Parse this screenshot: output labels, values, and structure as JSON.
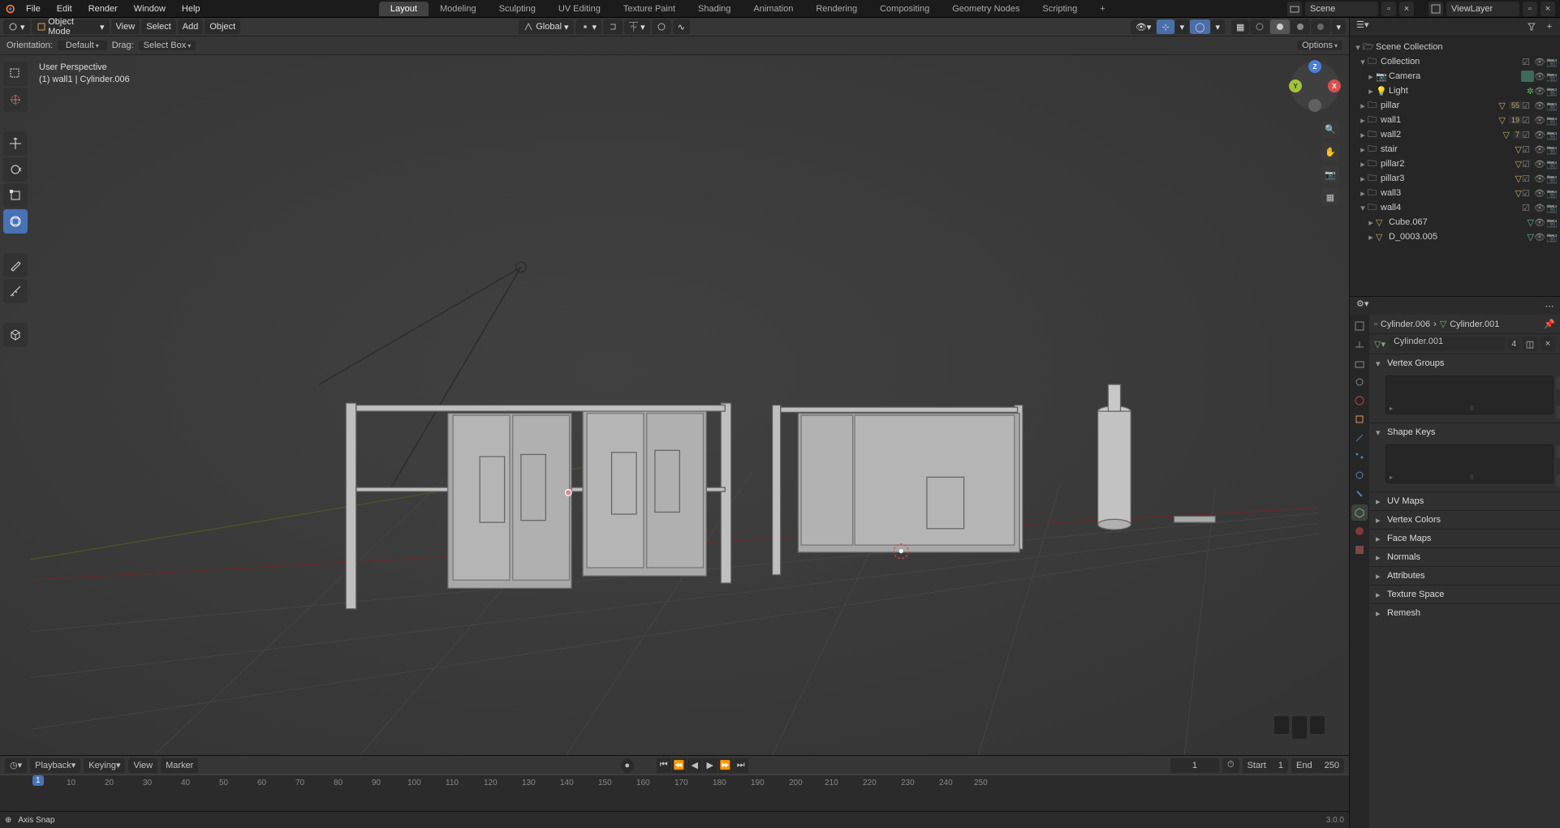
{
  "menu": {
    "file": "File",
    "edit": "Edit",
    "render": "Render",
    "window": "Window",
    "help": "Help"
  },
  "workspaces": [
    "Layout",
    "Modeling",
    "Sculpting",
    "UV Editing",
    "Texture Paint",
    "Shading",
    "Animation",
    "Rendering",
    "Compositing",
    "Geometry Nodes",
    "Scripting"
  ],
  "active_workspace": "Layout",
  "scene_name": "Scene",
  "view_layer_name": "ViewLayer",
  "mode": "Object Mode",
  "header_menus": {
    "view": "View",
    "select": "Select",
    "add": "Add",
    "object": "Object"
  },
  "transform_orientation_label": "Global",
  "tool_options": {
    "orientation": "Orientation:",
    "orientation_val": "Default",
    "drag": "Drag:",
    "drag_val": "Select Box",
    "options": "Options"
  },
  "overlay": {
    "line1": "User Perspective",
    "line2": "(1) wall1 | Cylinder.006"
  },
  "timeline": {
    "playback": "Playback",
    "keying": "Keying",
    "view": "View",
    "marker": "Marker",
    "current": "1",
    "start_label": "Start",
    "start": "1",
    "end_label": "End",
    "end": "250",
    "ticks": [
      "10",
      "20",
      "30",
      "40",
      "50",
      "60",
      "70",
      "80",
      "90",
      "100",
      "110",
      "120",
      "130",
      "140",
      "150",
      "160",
      "170",
      "180",
      "190",
      "200",
      "210",
      "220",
      "230",
      "240",
      "250"
    ]
  },
  "status": {
    "text": "Axis Snap"
  },
  "version": "3.0.0",
  "outliner": {
    "root": "Scene Collection",
    "collection": "Collection",
    "items": [
      {
        "name": "Camera",
        "icon": "camera"
      },
      {
        "name": "Light",
        "icon": "light"
      },
      {
        "name": "pillar",
        "icon": "coll",
        "badge": "55"
      },
      {
        "name": "wall1",
        "icon": "coll",
        "badge": "19"
      },
      {
        "name": "wall2",
        "icon": "coll",
        "badge": "7"
      },
      {
        "name": "stair",
        "icon": "coll"
      },
      {
        "name": "pillar2",
        "icon": "coll"
      },
      {
        "name": "pillar3",
        "icon": "coll"
      },
      {
        "name": "wall3",
        "icon": "coll"
      },
      {
        "name": "wall4",
        "icon": "coll",
        "open": true
      }
    ],
    "wall4_children": [
      {
        "name": "Cube.067"
      },
      {
        "name": "D_0003.005"
      }
    ]
  },
  "props": {
    "breadcrumb_obj": "Cylinder.006",
    "breadcrumb_data": "Cylinder.001",
    "mesh_name": "Cylinder.001",
    "mesh_users": "4",
    "panels": {
      "vertex_groups": "Vertex Groups",
      "shape_keys": "Shape Keys",
      "uv_maps": "UV Maps",
      "vertex_colors": "Vertex Colors",
      "face_maps": "Face Maps",
      "normals": "Normals",
      "attributes": "Attributes",
      "texture_space": "Texture Space",
      "remesh": "Remesh"
    }
  }
}
